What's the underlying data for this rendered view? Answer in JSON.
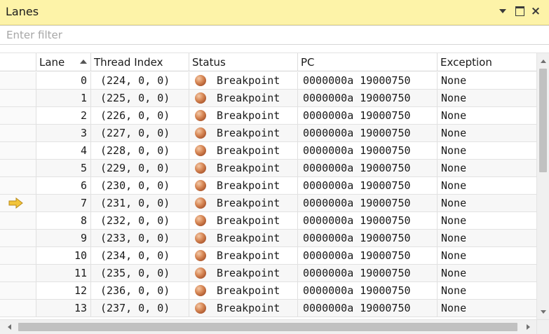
{
  "window": {
    "title": "Lanes",
    "menu_icon": "chevron-down-icon",
    "maximize_icon": "maximize-icon",
    "close_glyph": "×"
  },
  "filter": {
    "placeholder": "Enter filter",
    "value": ""
  },
  "columns": [
    {
      "key": "lane",
      "label": "Lane"
    },
    {
      "key": "thread",
      "label": "Thread Index"
    },
    {
      "key": "status",
      "label": "Status"
    },
    {
      "key": "pc",
      "label": "PC"
    },
    {
      "key": "exception",
      "label": "Exception"
    }
  ],
  "sort": {
    "column": "Lane",
    "direction": "ascending"
  },
  "current_lane": "7",
  "colors": {
    "titlebar": "#fdf3a8",
    "status_ball": "#d98a58",
    "current_arrow": "#f2c43a"
  },
  "rows": [
    {
      "lane": "0",
      "thread": "(224, 0, 0)",
      "status": "Breakpoint",
      "pc": "0000000a 19000750",
      "exception": "None"
    },
    {
      "lane": "1",
      "thread": "(225, 0, 0)",
      "status": "Breakpoint",
      "pc": "0000000a 19000750",
      "exception": "None"
    },
    {
      "lane": "2",
      "thread": "(226, 0, 0)",
      "status": "Breakpoint",
      "pc": "0000000a 19000750",
      "exception": "None"
    },
    {
      "lane": "3",
      "thread": "(227, 0, 0)",
      "status": "Breakpoint",
      "pc": "0000000a 19000750",
      "exception": "None"
    },
    {
      "lane": "4",
      "thread": "(228, 0, 0)",
      "status": "Breakpoint",
      "pc": "0000000a 19000750",
      "exception": "None"
    },
    {
      "lane": "5",
      "thread": "(229, 0, 0)",
      "status": "Breakpoint",
      "pc": "0000000a 19000750",
      "exception": "None"
    },
    {
      "lane": "6",
      "thread": "(230, 0, 0)",
      "status": "Breakpoint",
      "pc": "0000000a 19000750",
      "exception": "None"
    },
    {
      "lane": "7",
      "thread": "(231, 0, 0)",
      "status": "Breakpoint",
      "pc": "0000000a 19000750",
      "exception": "None"
    },
    {
      "lane": "8",
      "thread": "(232, 0, 0)",
      "status": "Breakpoint",
      "pc": "0000000a 19000750",
      "exception": "None"
    },
    {
      "lane": "9",
      "thread": "(233, 0, 0)",
      "status": "Breakpoint",
      "pc": "0000000a 19000750",
      "exception": "None"
    },
    {
      "lane": "10",
      "thread": "(234, 0, 0)",
      "status": "Breakpoint",
      "pc": "0000000a 19000750",
      "exception": "None"
    },
    {
      "lane": "11",
      "thread": "(235, 0, 0)",
      "status": "Breakpoint",
      "pc": "0000000a 19000750",
      "exception": "None"
    },
    {
      "lane": "12",
      "thread": "(236, 0, 0)",
      "status": "Breakpoint",
      "pc": "0000000a 19000750",
      "exception": "None"
    },
    {
      "lane": "13",
      "thread": "(237, 0, 0)",
      "status": "Breakpoint",
      "pc": "0000000a 19000750",
      "exception": "None"
    }
  ]
}
